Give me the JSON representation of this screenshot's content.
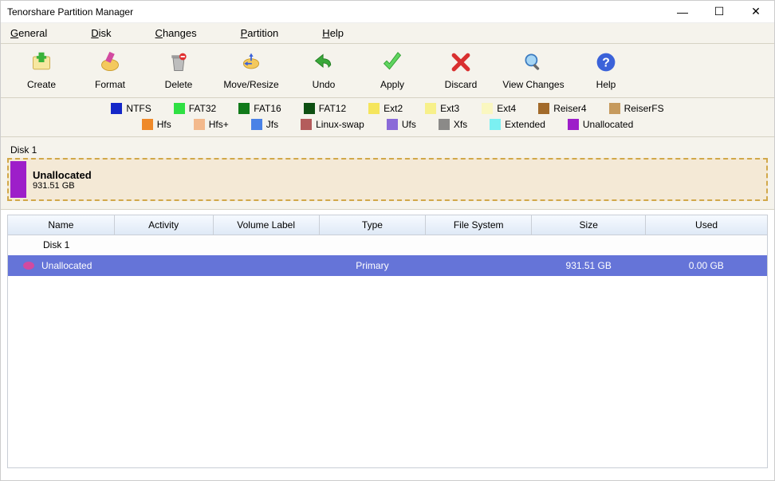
{
  "window": {
    "title": "Tenorshare Partition Manager"
  },
  "menu": {
    "items": [
      {
        "label": "General",
        "underline": "G"
      },
      {
        "label": "Disk",
        "underline": "D"
      },
      {
        "label": "Changes",
        "underline": "C"
      },
      {
        "label": "Partition",
        "underline": "P"
      },
      {
        "label": "Help",
        "underline": "H"
      }
    ]
  },
  "toolbar": {
    "create": "Create",
    "format": "Format",
    "delete": "Delete",
    "move_resize": "Move/Resize",
    "undo": "Undo",
    "apply": "Apply",
    "discard": "Discard",
    "view_changes": "View Changes",
    "help": "Help"
  },
  "legend": {
    "row1": [
      {
        "label": "NTFS",
        "color": "#1427c8"
      },
      {
        "label": "FAT32",
        "color": "#2fe043"
      },
      {
        "label": "FAT16",
        "color": "#117a1a"
      },
      {
        "label": "FAT12",
        "color": "#0e4f12"
      },
      {
        "label": "Ext2",
        "color": "#f5e55c"
      },
      {
        "label": "Ext3",
        "color": "#f7f08a"
      },
      {
        "label": "Ext4",
        "color": "#faf7c0"
      },
      {
        "label": "Reiser4",
        "color": "#a26a2a"
      },
      {
        "label": "ReiserFS",
        "color": "#c69a5d"
      }
    ],
    "row2": [
      {
        "label": "Hfs",
        "color": "#ef8a2a"
      },
      {
        "label": "Hfs+",
        "color": "#f3b98c"
      },
      {
        "label": "Jfs",
        "color": "#4a82e6"
      },
      {
        "label": "Linux-swap",
        "color": "#b45c5c"
      },
      {
        "label": "Ufs",
        "color": "#8a6ad8"
      },
      {
        "label": "Xfs",
        "color": "#8b8a88"
      },
      {
        "label": "Extended",
        "color": "#7bf0f2"
      },
      {
        "label": "Unallocated",
        "color": "#9d1ec9"
      }
    ]
  },
  "disk": {
    "title": "Disk 1",
    "partition_name": "Unallocated",
    "partition_size": "931.51 GB",
    "block_color": "#9d1ec9"
  },
  "table": {
    "headers": {
      "name": "Name",
      "activity": "Activity",
      "volume_label": "Volume Label",
      "type": "Type",
      "file_system": "File System",
      "size": "Size",
      "used": "Used"
    },
    "disk_row": {
      "name": "Disk 1"
    },
    "rows": [
      {
        "name": "Unallocated",
        "activity": "",
        "volume_label": "",
        "type": "Primary",
        "file_system": "",
        "size": "931.51 GB",
        "used": "0.00 GB"
      }
    ]
  }
}
